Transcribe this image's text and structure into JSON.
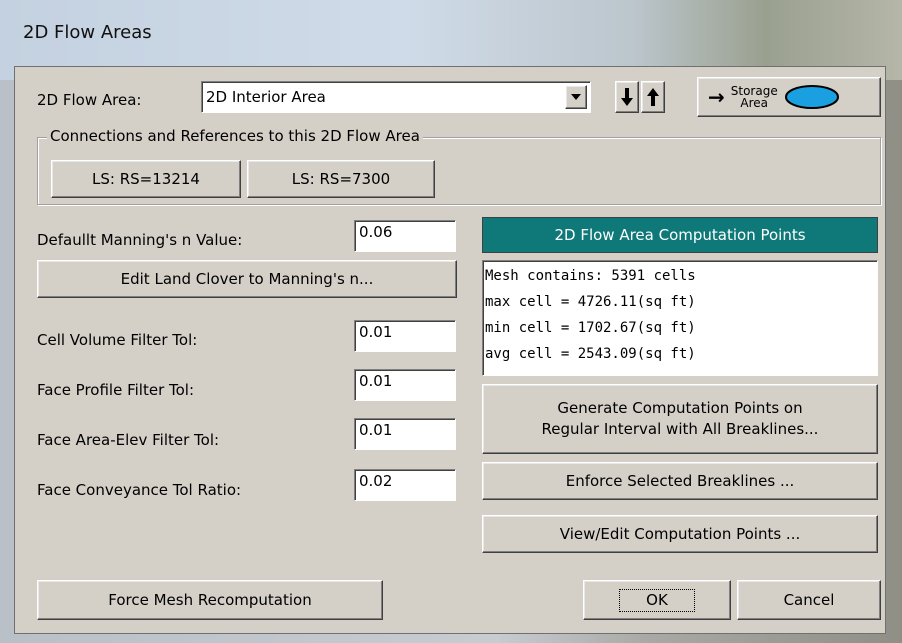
{
  "window": {
    "title": "2D Flow Areas"
  },
  "flow_area": {
    "label": "2D Flow Area:",
    "selected": "2D Interior Area",
    "dropdown_icon": "chevron-down-icon",
    "down_icon": "arrow-down-icon",
    "up_icon": "arrow-up-icon",
    "storage_button": {
      "arrow": "→",
      "line1": "Storage",
      "line2": "Area"
    }
  },
  "connections": {
    "title": "Connections and References to this 2D Flow Area",
    "buttons": [
      "LS: RS=13214",
      "LS: RS=7300"
    ]
  },
  "mannings": {
    "label": "Defaullt Manning's n Value:",
    "value": "0.06",
    "edit_button": "Edit Land Clover to Manning's n..."
  },
  "tolerances": [
    {
      "label": "Cell Volume Filter Tol:",
      "value": "0.01"
    },
    {
      "label": "Face Profile Filter Tol:",
      "value": "0.01"
    },
    {
      "label": "Face Area-Elev Filter Tol:",
      "value": "0.01"
    },
    {
      "label": "Face Conveyance Tol Ratio:",
      "value": "0.02"
    }
  ],
  "computation_points": {
    "header": "2D Flow Area Computation Points",
    "header_color": "#0f7878",
    "info_lines": [
      "Mesh contains: 5391 cells",
      "max cell = 4726.11(sq ft)",
      "min cell = 1702.67(sq ft)",
      "avg cell = 2543.09(sq ft)"
    ],
    "generate_line1": "Generate Computation Points on",
    "generate_line2": "Regular Interval with All Breaklines...",
    "enforce_button": "Enforce Selected Breaklines ...",
    "view_button": "View/Edit Computation Points ..."
  },
  "footer": {
    "force_button": "Force Mesh Recomputation",
    "ok_button": "OK",
    "cancel_button": "Cancel"
  }
}
